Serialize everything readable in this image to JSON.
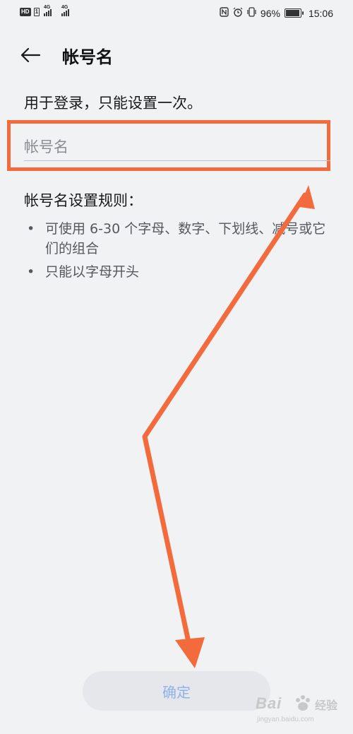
{
  "status_bar": {
    "hd": "HD",
    "sim1": "1",
    "net1": "4G",
    "net2": "4G",
    "battery_percent": "96%",
    "battery_level": 0.96,
    "time": "15:06",
    "icons": [
      "nfc-icon",
      "alarm-icon",
      "vibrate-icon",
      "battery-icon"
    ]
  },
  "header": {
    "back_icon": "arrow-left-icon",
    "title": "帐号名"
  },
  "subtitle": "用于登录，只能设置一次。",
  "input": {
    "placeholder": "帐号名",
    "value": ""
  },
  "rules": {
    "title": "帐号名设置规则：",
    "items": [
      "可使用 6-30 个字母、数字、下划线、减号或它们的组合",
      "只能以字母开头"
    ]
  },
  "confirm_button": {
    "label": "确定"
  },
  "annotation": {
    "color": "#f36b3c"
  },
  "watermark": {
    "text_main": "Bai",
    "text_cn": "经验",
    "url": "jingyan.baidu.com"
  }
}
